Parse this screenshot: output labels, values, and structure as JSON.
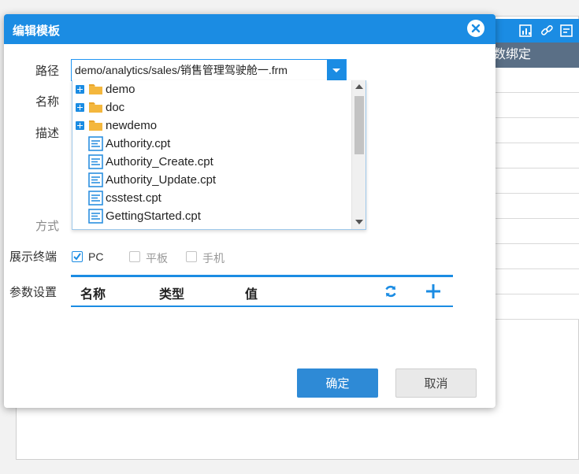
{
  "background": {
    "header_label": "数绑定"
  },
  "dialog": {
    "title": "编辑模板",
    "labels": {
      "path": "路径",
      "name": "名称",
      "description": "描述",
      "mode": "方式",
      "terminals": "展示终端",
      "params": "参数设置"
    },
    "path_value": "demo/analytics/sales/销售管理驾驶舱一.frm",
    "tree_items": [
      {
        "type": "folder",
        "label": "demo"
      },
      {
        "type": "folder",
        "label": "doc"
      },
      {
        "type": "folder",
        "label": "newdemo"
      },
      {
        "type": "file",
        "label": "Authority.cpt"
      },
      {
        "type": "file",
        "label": "Authority_Create.cpt"
      },
      {
        "type": "file",
        "label": "Authority_Update.cpt"
      },
      {
        "type": "file",
        "label": "csstest.cpt"
      },
      {
        "type": "file",
        "label": "GettingStarted.cpt"
      }
    ],
    "terminals": [
      {
        "label": "PC",
        "checked": true
      },
      {
        "label": "平板",
        "checked": false
      },
      {
        "label": "手机",
        "checked": false
      }
    ],
    "param_columns": [
      "名称",
      "类型",
      "值"
    ],
    "buttons": {
      "confirm": "确定",
      "cancel": "取消"
    }
  },
  "colors": {
    "accent": "#1b8ce3",
    "primary_button": "#2e8ad6",
    "background_subheader": "#5a6f86"
  }
}
